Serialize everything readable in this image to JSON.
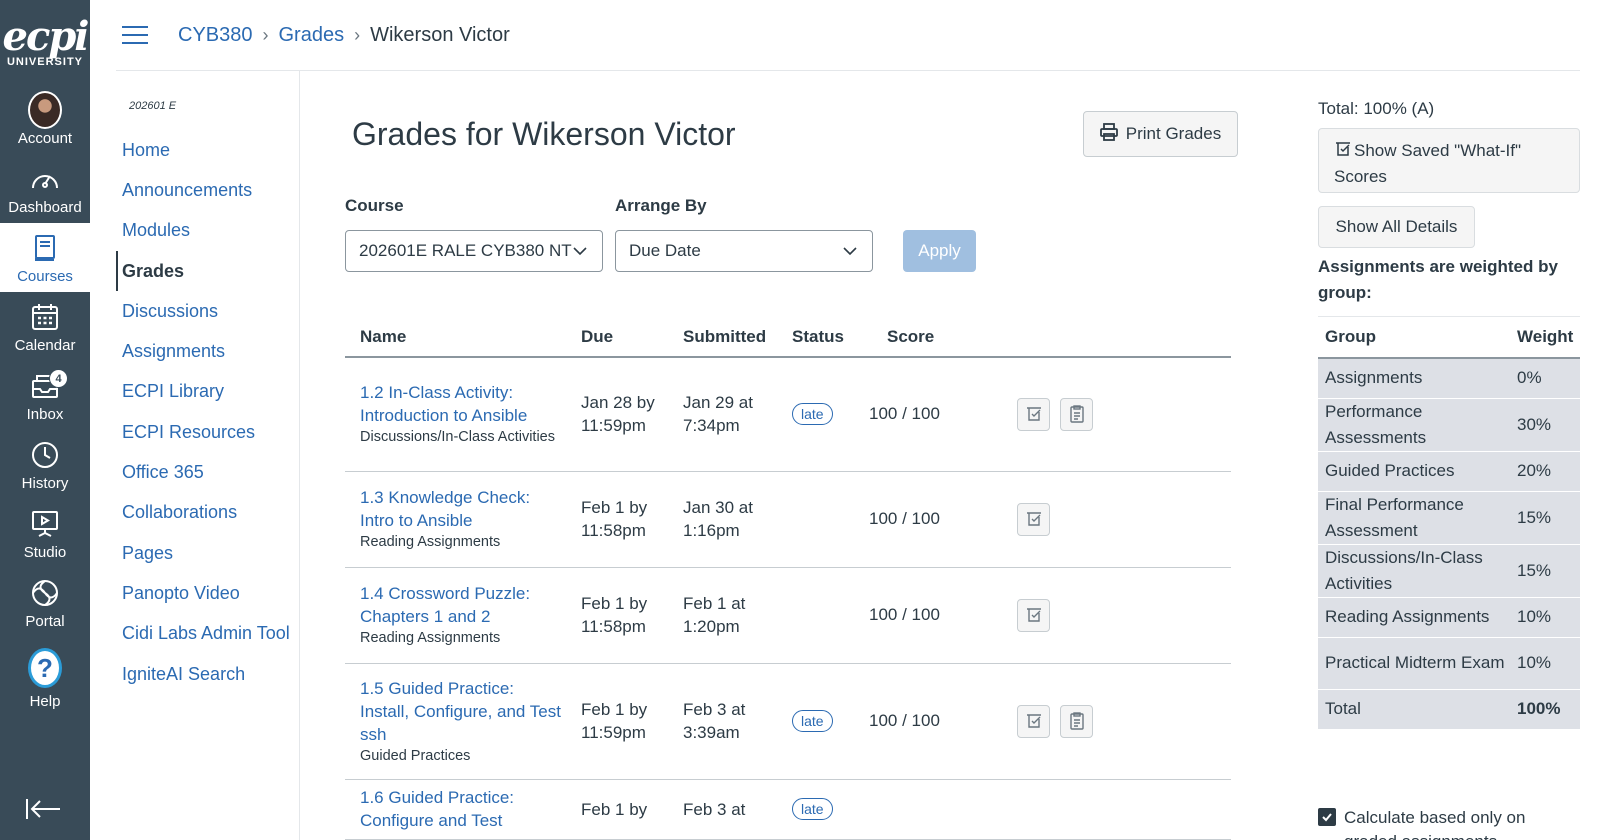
{
  "global_nav": {
    "logo_main": "ecpi",
    "logo_sub": "UNIVERSITY",
    "items": [
      {
        "label": "Account"
      },
      {
        "label": "Dashboard"
      },
      {
        "label": "Courses"
      },
      {
        "label": "Calendar"
      },
      {
        "label": "Inbox",
        "badge": "4"
      },
      {
        "label": "History"
      },
      {
        "label": "Studio"
      },
      {
        "label": "Portal"
      },
      {
        "label": "Help"
      }
    ]
  },
  "breadcrumb": [
    "CYB380",
    "Grades",
    "Wikerson Victor"
  ],
  "course_nav": {
    "term": "202601 E",
    "items": [
      "Home",
      "Announcements",
      "Modules",
      "Grades",
      "Discussions",
      "Assignments",
      "ECPI Library",
      "ECPI Resources",
      "Office 365",
      "Collaborations",
      "Pages",
      "Panopto Video",
      "Cidi Labs Admin Tool",
      "IgniteAI Search"
    ],
    "active_index": 3
  },
  "main": {
    "title": "Grades for Wikerson Victor",
    "print_label": "Print Grades",
    "course_label": "Course",
    "course_value": "202601E RALE CYB380 NT",
    "arrange_label": "Arrange By",
    "arrange_value": "Due Date",
    "apply_label": "Apply",
    "columns": [
      "Name",
      "Due",
      "Submitted",
      "Status",
      "Score"
    ],
    "rows": [
      {
        "name": "1.2 In-Class Activity: Introduction to Ansible",
        "group": "Discussions/In-Class Activities",
        "due": "Jan 28 by 11:59pm",
        "submitted": "Jan 29 at 7:34pm",
        "status": "late",
        "score": "100 / 100",
        "rubric": true
      },
      {
        "name": "1.3 Knowledge Check: Intro to Ansible",
        "group": "Reading Assignments",
        "due": "Feb 1 by 11:58pm",
        "submitted": "Jan 30 at 1:16pm",
        "status": "",
        "score": "100 / 100",
        "rubric": false
      },
      {
        "name": "1.4 Crossword Puzzle: Chapters 1 and 2",
        "group": "Reading Assignments",
        "due": "Feb 1 by 11:58pm",
        "submitted": "Feb 1 at 1:20pm",
        "status": "",
        "score": "100 / 100",
        "rubric": false
      },
      {
        "name": "1.5 Guided Practice: Install, Configure, and Test ssh",
        "group": "Guided Practices",
        "due": "Feb 1 by 11:59pm",
        "submitted": "Feb 3 at 3:39am",
        "status": "late",
        "score": "100 / 100",
        "rubric": true
      },
      {
        "name": "1.6 Guided Practice: Configure and Test",
        "group": "",
        "due": "Feb 1 by",
        "submitted": "Feb 3 at",
        "status": "late",
        "score": "",
        "rubric": false
      }
    ]
  },
  "sidebar": {
    "total": "Total: 100% (A)",
    "what_if_label": "Show Saved \"What-If\" Scores",
    "show_all_label": "Show All Details",
    "weighted_note": "Assignments are weighted by group:",
    "weight_headers": [
      "Group",
      "Weight"
    ],
    "weights": [
      {
        "group": "Assignments",
        "weight": "0%"
      },
      {
        "group": "Performance Assessments",
        "weight": "30%"
      },
      {
        "group": "Guided Practices",
        "weight": "20%"
      },
      {
        "group": "Final Performance Assessment",
        "weight": "15%"
      },
      {
        "group": "Discussions/In-Class Activities",
        "weight": "15%"
      },
      {
        "group": "Reading Assignments",
        "weight": "10%"
      },
      {
        "group": "Practical Midterm Exam",
        "weight": "10%"
      }
    ],
    "weight_total": {
      "group": "Total",
      "weight": "100%"
    },
    "calc_label": "Calculate based only on graded assignments"
  },
  "colors": {
    "nav_bg": "#394b58",
    "link": "#2b6ab2",
    "text": "#2d3b45",
    "apply_disabled": "#a0bfe0",
    "table_row_bg": "#dde0e6"
  }
}
